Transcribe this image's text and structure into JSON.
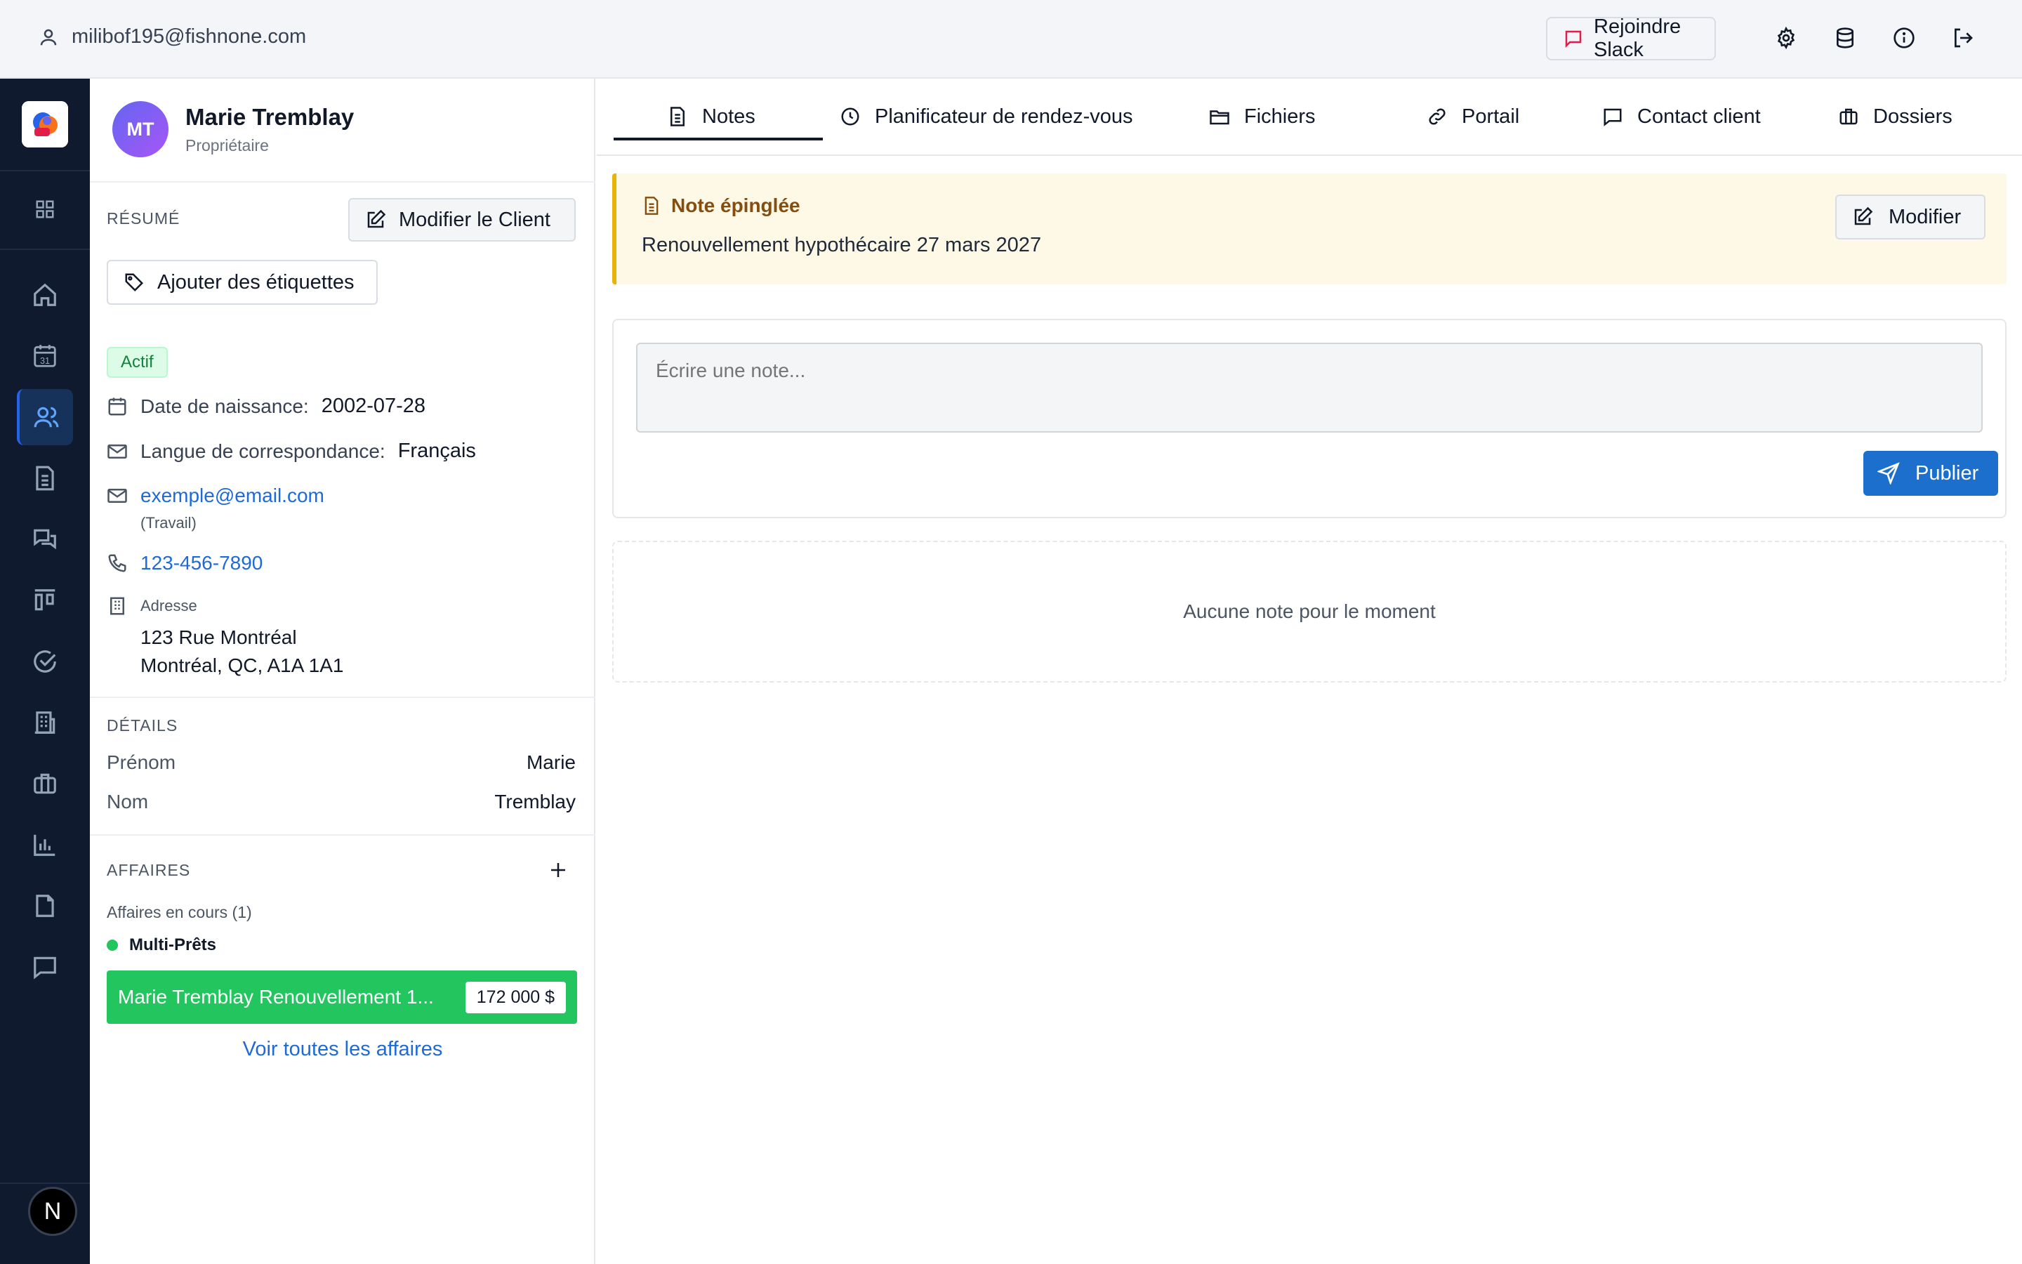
{
  "topbar": {
    "user_email": "milibof195@fishnone.com",
    "slack_label": "Rejoindre Slack",
    "icons": [
      "settings-icon",
      "database-icon",
      "info-icon",
      "logout-icon"
    ]
  },
  "rail": {
    "items": [
      "apps-grid-icon",
      "home-icon",
      "calendar-icon",
      "users-icon",
      "document-icon",
      "chat-icon",
      "kanban-icon",
      "check-circle-icon",
      "building-icon",
      "briefcase-icon",
      "bar-chart-icon",
      "file-icon",
      "message-icon"
    ],
    "calendar_day": "31",
    "active": "users-icon",
    "badge_letter": "N"
  },
  "client": {
    "initials": "MT",
    "name": "Marie Tremblay",
    "role": "Propriétaire",
    "summary_label": "Résumé",
    "edit_label": "Modifier le Client",
    "tags_label": "Ajouter des étiquettes",
    "status": "Actif",
    "birth_label": "Date de naissance:",
    "birth_value": "2002-07-28",
    "lang_label": "Langue de correspondance:",
    "lang_value": "Français",
    "email": "exemple@email.com",
    "email_type": "(Travail)",
    "phone": "123-456-7890",
    "address_label": "Adresse",
    "address_line1": "123 Rue Montréal",
    "address_line2": "Montréal, QC, A1A 1A1"
  },
  "details": {
    "label": "Détails",
    "first_name_label": "Prénom",
    "first_name": "Marie",
    "last_name_label": "Nom",
    "last_name": "Tremblay"
  },
  "deals": {
    "label": "Affaires",
    "in_progress": "Affaires en cours (1)",
    "group": "Multi-Prêts",
    "deal_title": "Marie Tremblay Renouvellement 1...",
    "deal_amount": "172 000 $",
    "view_all": "Voir toutes les affaires",
    "accent": "#22c55e"
  },
  "tabs": [
    {
      "label": "Notes",
      "icon": "document-icon",
      "active": true
    },
    {
      "label": "Planificateur de rendez-vous",
      "icon": "clock-icon"
    },
    {
      "label": "Fichiers",
      "icon": "folder-icon"
    },
    {
      "label": "Portail",
      "icon": "link-icon"
    },
    {
      "label": "Contact client",
      "icon": "chat-icon"
    },
    {
      "label": "Dossiers",
      "icon": "briefcase-icon"
    }
  ],
  "pinned": {
    "title": "Note épinglée",
    "text": "Renouvellement hypothécaire 27 mars 2027",
    "edit_label": "Modifier",
    "bg": "#fef9e7",
    "border": "#eab308"
  },
  "composer": {
    "placeholder": "Écrire une note...",
    "publish_label": "Publier",
    "accent": "#1d6fce"
  },
  "notes_empty": "Aucune note pour le moment"
}
